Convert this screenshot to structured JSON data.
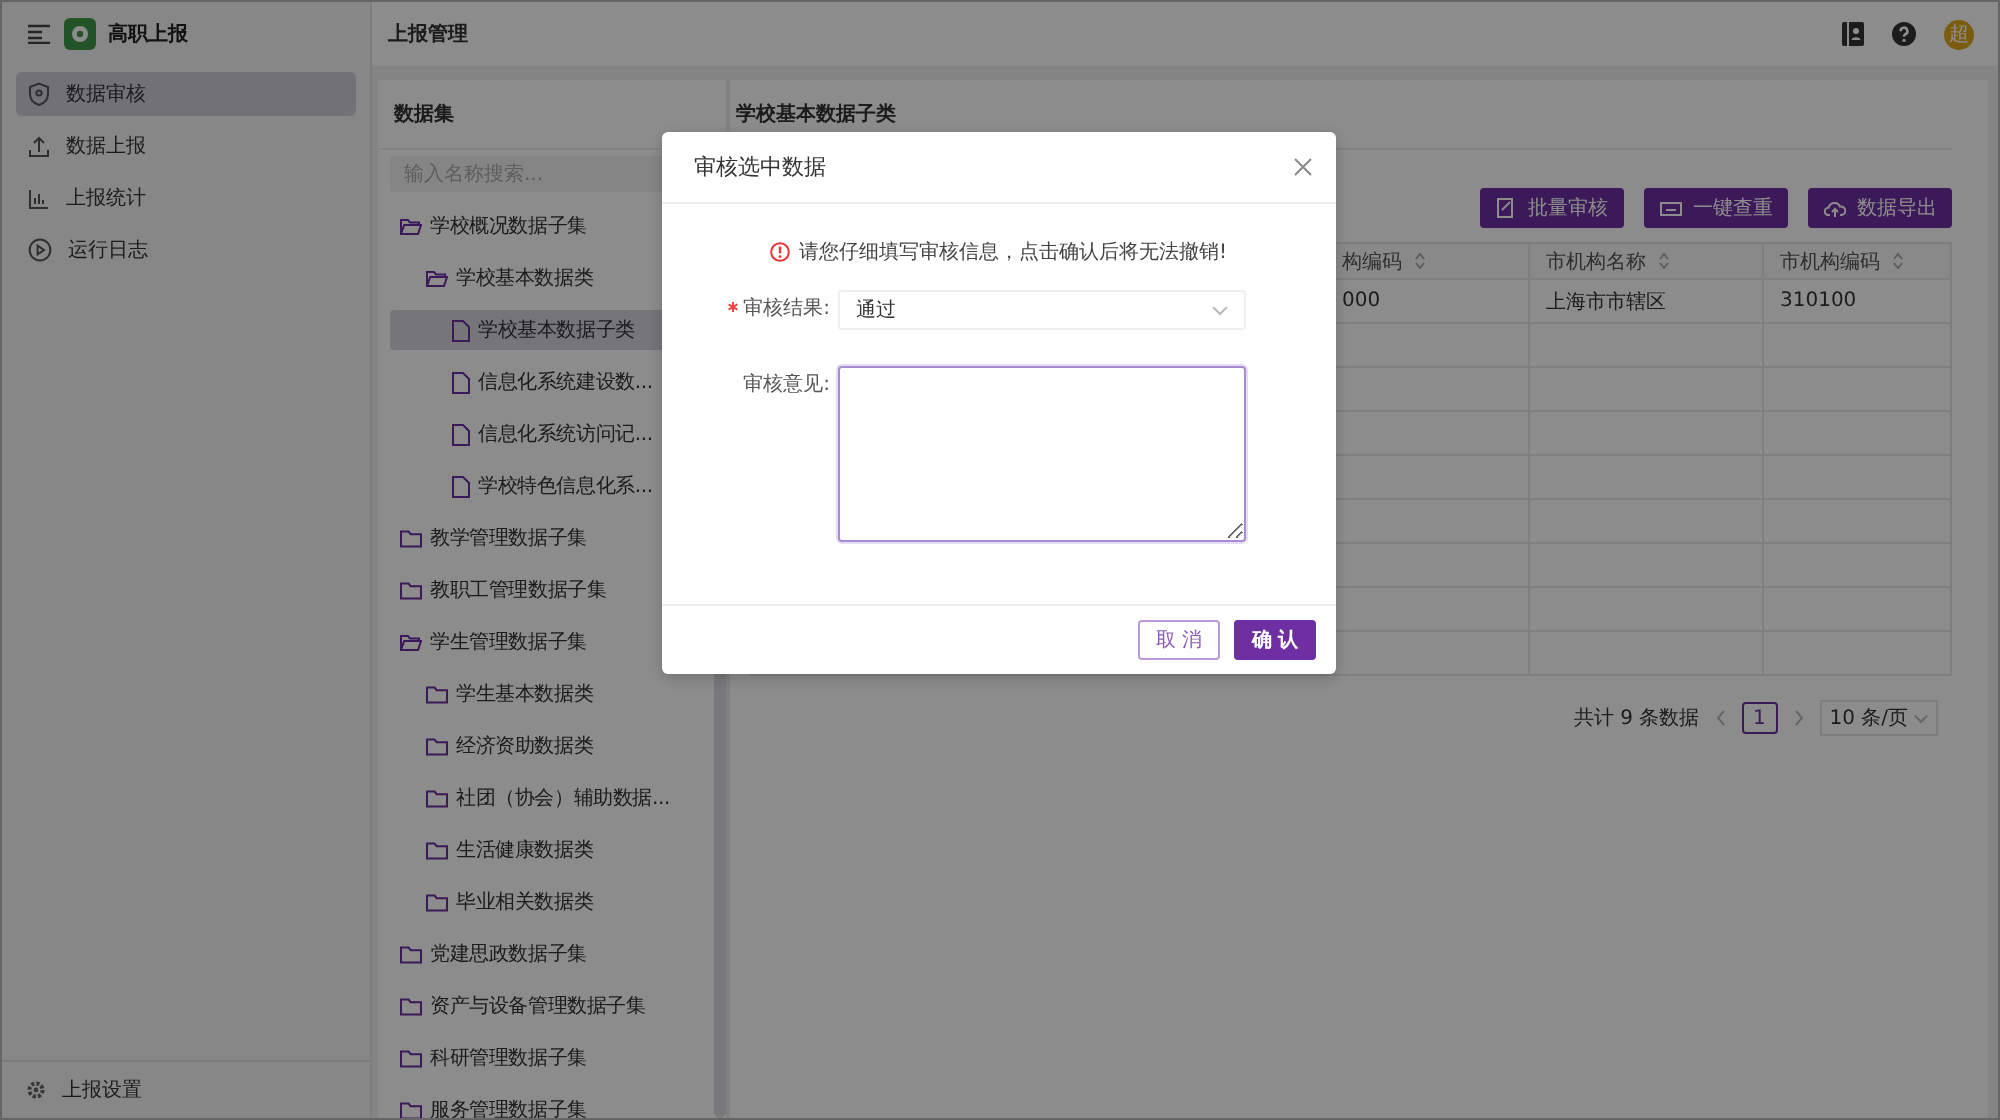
{
  "app": {
    "title": "高职上报"
  },
  "sidebar": {
    "items": [
      {
        "label": "数据审核",
        "selected": true
      },
      {
        "label": "数据上报",
        "selected": false
      },
      {
        "label": "上报统计",
        "selected": false
      },
      {
        "label": "运行日志",
        "selected": false
      }
    ],
    "footer": {
      "label": "上报设置"
    }
  },
  "header": {
    "title": "上报管理",
    "avatar": "超"
  },
  "dataset_panel": {
    "title": "数据集",
    "search": {
      "placeholder": "输入名称搜索..."
    },
    "tree": [
      {
        "label": "学校概况数据子集",
        "kind": "folder",
        "expanded": true,
        "selected": false,
        "children": [
          {
            "label": "学校基本数据类",
            "kind": "folder",
            "expanded": true,
            "selected": false,
            "children": [
              {
                "label": "学校基本数据子类",
                "kind": "file",
                "selected": true
              },
              {
                "label": "信息化系统建设数...",
                "kind": "file",
                "selected": false
              },
              {
                "label": "信息化系统访问记...",
                "kind": "file",
                "selected": false
              },
              {
                "label": "学校特色信息化系...",
                "kind": "file",
                "selected": false
              }
            ]
          }
        ]
      },
      {
        "label": "教学管理数据子集",
        "kind": "folder",
        "expanded": false,
        "selected": false
      },
      {
        "label": "教职工管理数据子集",
        "kind": "folder",
        "expanded": false,
        "selected": false
      },
      {
        "label": "学生管理数据子集",
        "kind": "folder",
        "expanded": true,
        "selected": false,
        "children": [
          {
            "label": "学生基本数据类",
            "kind": "folder",
            "expanded": false,
            "selected": false
          },
          {
            "label": "经济资助数据类",
            "kind": "folder",
            "expanded": false,
            "selected": false
          },
          {
            "label": "社团（协会）辅助数据...",
            "kind": "folder",
            "expanded": false,
            "selected": false
          },
          {
            "label": "生活健康数据类",
            "kind": "folder",
            "expanded": false,
            "selected": false
          },
          {
            "label": "毕业相关数据类",
            "kind": "folder",
            "expanded": false,
            "selected": false
          }
        ]
      },
      {
        "label": "党建思政数据子集",
        "kind": "folder",
        "expanded": false,
        "selected": false
      },
      {
        "label": "资产与设备管理数据子集",
        "kind": "folder",
        "expanded": false,
        "selected": false
      },
      {
        "label": "科研管理数据子集",
        "kind": "folder",
        "expanded": false,
        "selected": false
      },
      {
        "label": "服务管理数据子集",
        "kind": "folder",
        "expanded": false,
        "selected": false
      }
    ]
  },
  "content": {
    "title": "学校基本数据子类",
    "buttons": [
      "批量审核",
      "一键查重",
      "数据导出"
    ],
    "table": {
      "columns": [
        "构编码",
        "市机构名称",
        "市机构编码"
      ],
      "rows": [
        [
          "000",
          "上海市市辖区",
          "310100"
        ]
      ]
    },
    "pagination": {
      "total": "共计 9 条数据",
      "pages": [
        {
          "label": "1",
          "selected": true
        }
      ],
      "page_size": "10 条/页"
    }
  },
  "dialog": {
    "title": "审核选中数据",
    "warning": "请您仔细填写审核信息，点击确认后将无法撤销!",
    "fields": [
      {
        "kind": "select",
        "label": "审核结果:",
        "required": true,
        "value": "通过"
      },
      {
        "kind": "textarea",
        "label": "审核意见:",
        "required": false,
        "focused": true
      }
    ],
    "buttons": [
      {
        "label": "取消",
        "kind": "secondary"
      },
      {
        "label": "确认",
        "kind": "primary"
      }
    ]
  }
}
